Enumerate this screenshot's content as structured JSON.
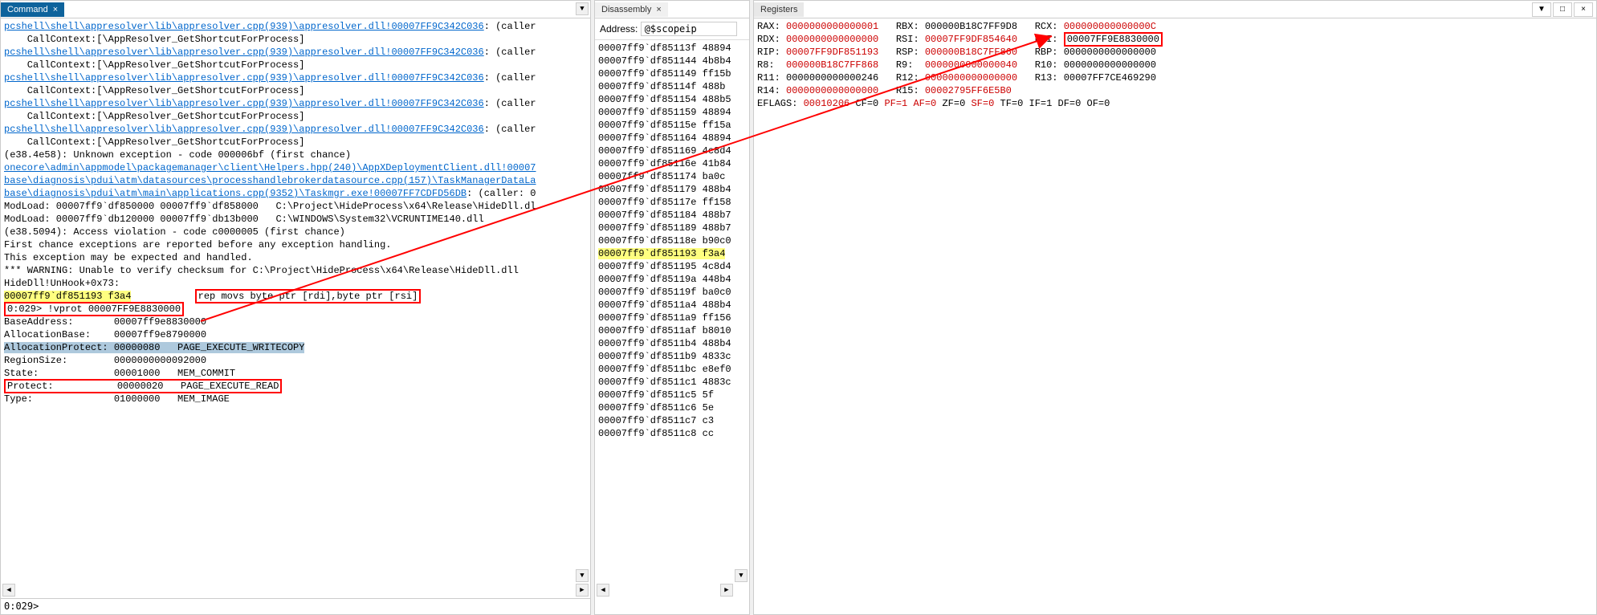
{
  "command": {
    "tab": "Command",
    "lines": [
      {
        "t": "pcshell\\shell\\appresolver\\lib\\appresolver.cpp(939)\\appresolver.dll!00007FF9C342C036",
        "link": true,
        "suffix": ": (caller"
      },
      {
        "t": "    CallContext:[\\AppResolver_GetShortcutForProcess] "
      },
      {
        "t": "pcshell\\shell\\appresolver\\lib\\appresolver.cpp(939)\\appresolver.dll!00007FF9C342C036",
        "link": true,
        "suffix": ": (caller"
      },
      {
        "t": "    CallContext:[\\AppResolver_GetShortcutForProcess] "
      },
      {
        "t": "pcshell\\shell\\appresolver\\lib\\appresolver.cpp(939)\\appresolver.dll!00007FF9C342C036",
        "link": true,
        "suffix": ": (caller"
      },
      {
        "t": "    CallContext:[\\AppResolver_GetShortcutForProcess] "
      },
      {
        "t": "pcshell\\shell\\appresolver\\lib\\appresolver.cpp(939)\\appresolver.dll!00007FF9C342C036",
        "link": true,
        "suffix": ": (caller"
      },
      {
        "t": "    CallContext:[\\AppResolver_GetShortcutForProcess] "
      },
      {
        "t": "pcshell\\shell\\appresolver\\lib\\appresolver.cpp(939)\\appresolver.dll!00007FF9C342C036",
        "link": true,
        "suffix": ": (caller"
      },
      {
        "t": "    CallContext:[\\AppResolver_GetShortcutForProcess] "
      },
      {
        "t": "(e38.4e58): Unknown exception - code 000006bf (first chance)"
      },
      {
        "t": "onecore\\admin\\appmodel\\packagemanager\\client\\Helpers.hpp(240)\\AppXDeploymentClient.dll!00007",
        "link": true
      },
      {
        "t": "base\\diagnosis\\pdui\\atm\\datasources\\processhandlebrokerdatasource.cpp(157)\\TaskManagerDataLa",
        "link": true
      },
      {
        "t": "base\\diagnosis\\pdui\\atm\\main\\applications.cpp(9352)\\Taskmgr.exe!00007FF7CDFD56DB",
        "link": true,
        "suffix": ": (caller: 0"
      },
      {
        "t": "ModLoad: 00007ff9`df850000 00007ff9`df858000   C:\\Project\\HideProcess\\x64\\Release\\HideDll.dl"
      },
      {
        "t": "ModLoad: 00007ff9`db120000 00007ff9`db13b000   C:\\WINDOWS\\System32\\VCRUNTIME140.dll"
      },
      {
        "t": "(e38.5094): Access violation - code c0000005 (first chance)"
      },
      {
        "t": "First chance exceptions are reported before any exception handling."
      },
      {
        "t": "This exception may be expected and handled."
      },
      {
        "t": "*** WARNING: Unable to verify checksum for C:\\Project\\HideProcess\\x64\\Release\\HideDll.dll"
      },
      {
        "t": "HideDll!UnHook+0x73:"
      }
    ],
    "rip_line_addr": "00007ff9`df851193 f3a4",
    "rip_line_inst": "rep movs byte ptr [rdi],byte ptr [rsi]",
    "vprot_cmd": "0:029> !vprot 00007FF9E8830000",
    "vprot_rows": [
      [
        "BaseAddress:      ",
        "00007ff9e8830000",
        ""
      ],
      [
        "AllocationBase:   ",
        "00007ff9e8790000",
        ""
      ],
      [
        "AllocationProtect:",
        "00000080",
        "PAGE_EXECUTE_WRITECOPY"
      ],
      [
        "RegionSize:       ",
        "0000000000092000",
        ""
      ],
      [
        "State:            ",
        "00001000",
        "MEM_COMMIT"
      ],
      [
        "Protect:          ",
        "00000020",
        "PAGE_EXECUTE_READ"
      ],
      [
        "Type:             ",
        "01000000",
        "MEM_IMAGE"
      ]
    ],
    "prompt": "0:029>"
  },
  "disasm": {
    "tab": "Disassembly",
    "addr_label": "Address:",
    "addr_value": "@$scopeip",
    "lines": [
      "00007ff9`df85113f 48894",
      "00007ff9`df851144 4b8b4",
      "00007ff9`df851149 ff15b",
      "00007ff9`df85114f 488b",
      "00007ff9`df851154 488b5",
      "00007ff9`df851159 48894",
      "00007ff9`df85115e ff15a",
      "00007ff9`df851164 48894",
      "00007ff9`df851169 4c8d4",
      "00007ff9`df85116e 41b84",
      "00007ff9`df851174 ba0c",
      "00007ff9`df851179 488b4",
      "00007ff9`df85117e ff158",
      "00007ff9`df851184 488b7",
      "00007ff9`df851189 488b7",
      "00007ff9`df85118e b90c0",
      "00007ff9`df851195 4c8d4",
      "00007ff9`df85119a 448b4",
      "00007ff9`df85119f ba0c0",
      "00007ff9`df8511a4 488b4",
      "00007ff9`df8511a9 ff156",
      "00007ff9`df8511af b8010",
      "00007ff9`df8511b4 488b4",
      "00007ff9`df8511b9 4833c",
      "00007ff9`df8511bc e8ef0",
      "00007ff9`df8511c1 4883c",
      "00007ff9`df8511c5 5f",
      "00007ff9`df8511c6 5e",
      "00007ff9`df8511c7 c3",
      "00007ff9`df8511c8 cc"
    ],
    "hl_line": "00007ff9`df851193 f3a4"
  },
  "registers": {
    "tab": "Registers",
    "rows": [
      [
        [
          "RAX:",
          "0000000000000001",
          true
        ],
        [
          "RBX:",
          "000000B18C7FF9D8",
          false
        ],
        [
          "RCX:",
          "000000000000000C",
          true
        ]
      ],
      [
        [
          "RDX:",
          "0000000000000000",
          true
        ],
        [
          "RSI:",
          "00007FF9DF854640",
          true
        ],
        [
          "RDI:",
          "00007FF9E8830000",
          false,
          "boxed"
        ]
      ],
      [
        [
          "RIP:",
          "00007FF9DF851193",
          true
        ],
        [
          "RSP:",
          "000000B18C7FF860",
          true
        ],
        [
          "RBP:",
          "0000000000000000",
          false
        ]
      ],
      [
        [
          "R8: ",
          "000000B18C7FF868",
          true
        ],
        [
          "R9: ",
          "0000000000000040",
          true
        ],
        [
          "R10:",
          "0000000000000000",
          false
        ]
      ],
      [
        [
          "R11:",
          "0000000000000246",
          false
        ],
        [
          "R12:",
          "0000000000000000",
          true
        ],
        [
          "R13:",
          "00007FF7CE469290",
          false
        ]
      ],
      [
        [
          "R14:",
          "0000000000000000",
          true
        ],
        [
          "R15:",
          "00002795FF6E5B0",
          true
        ]
      ]
    ],
    "eflags": "EFLAGS: 00010206 CF=0 PF=1 AF=0 ZF=0 SF=0 TF=0 IF=1 DF=0 OF=0"
  }
}
